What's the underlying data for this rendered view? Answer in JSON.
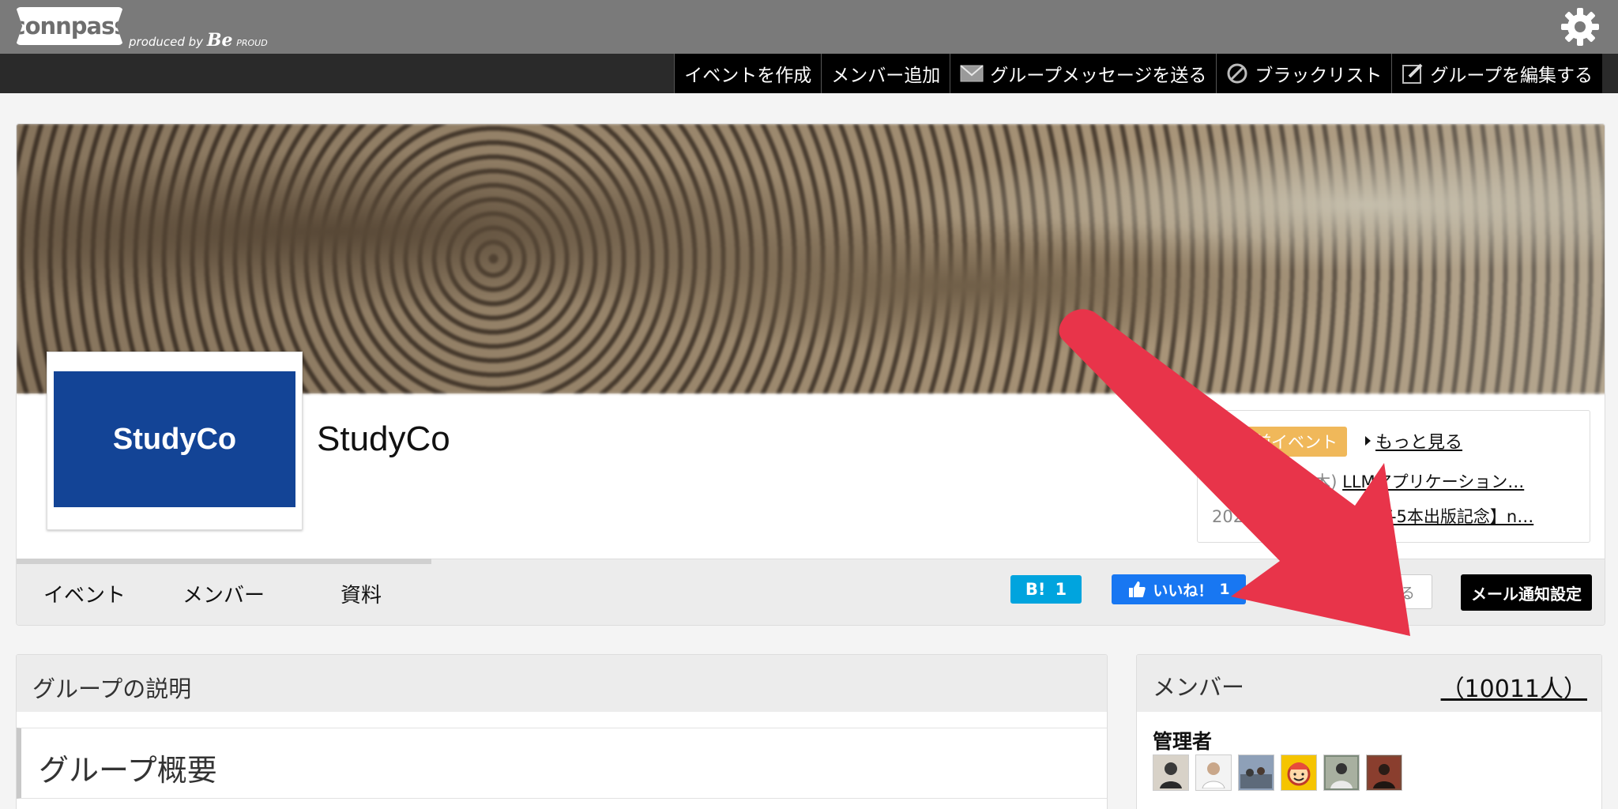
{
  "header": {
    "logo_text": "connpass",
    "produced_by": "produced by",
    "produced_brand": "Be",
    "produced_brand_suffix": "PROUD",
    "settings_icon": "gear-icon"
  },
  "toolbar": {
    "items": [
      {
        "label": "イベントを作成",
        "icon": ""
      },
      {
        "label": "メンバー追加",
        "icon": ""
      },
      {
        "label": "グループメッセージを送る",
        "icon": "mail-icon"
      },
      {
        "label": "ブラックリスト",
        "icon": "prohibit-icon"
      },
      {
        "label": "グループを編集する",
        "icon": "edit-icon"
      }
    ]
  },
  "group": {
    "logo_text": "StudyCo",
    "name": "StudyCo",
    "upcoming": {
      "badge": "開催前イベント",
      "more": "もっと見る",
      "events": [
        {
          "date": "2025/09/11(木)",
          "title": "LLMアプリケーション…"
        },
        {
          "date": "2025/09/25(木)",
          "title": "【GPT-5本出版記念】n…"
        }
      ]
    },
    "tabs": [
      "イベント",
      "メンバー",
      "資料"
    ],
    "hatena": {
      "label": "B!",
      "count": "1"
    },
    "facebook": {
      "label": "いいね！",
      "count": "1"
    },
    "leave_label": "退会する",
    "mail_settings_label": "メール通知設定"
  },
  "description": {
    "heading": "グループの説明",
    "overview": "グループ概要"
  },
  "members": {
    "heading": "メンバー",
    "count": "（10011人）",
    "admin_label": "管理者",
    "admin_avatar_colors": [
      "#d8d2c8",
      "#f3f3f3",
      "#8ea0b8",
      "#f5c400",
      "#7c8a7a",
      "#7a4b3a"
    ]
  },
  "colors": {
    "annotation_arrow": "#e8344a",
    "hatena_blue": "#00a4de",
    "facebook_blue": "#1877f2",
    "upcoming_badge": "#f0b85a",
    "logo_blue": "#134496"
  }
}
